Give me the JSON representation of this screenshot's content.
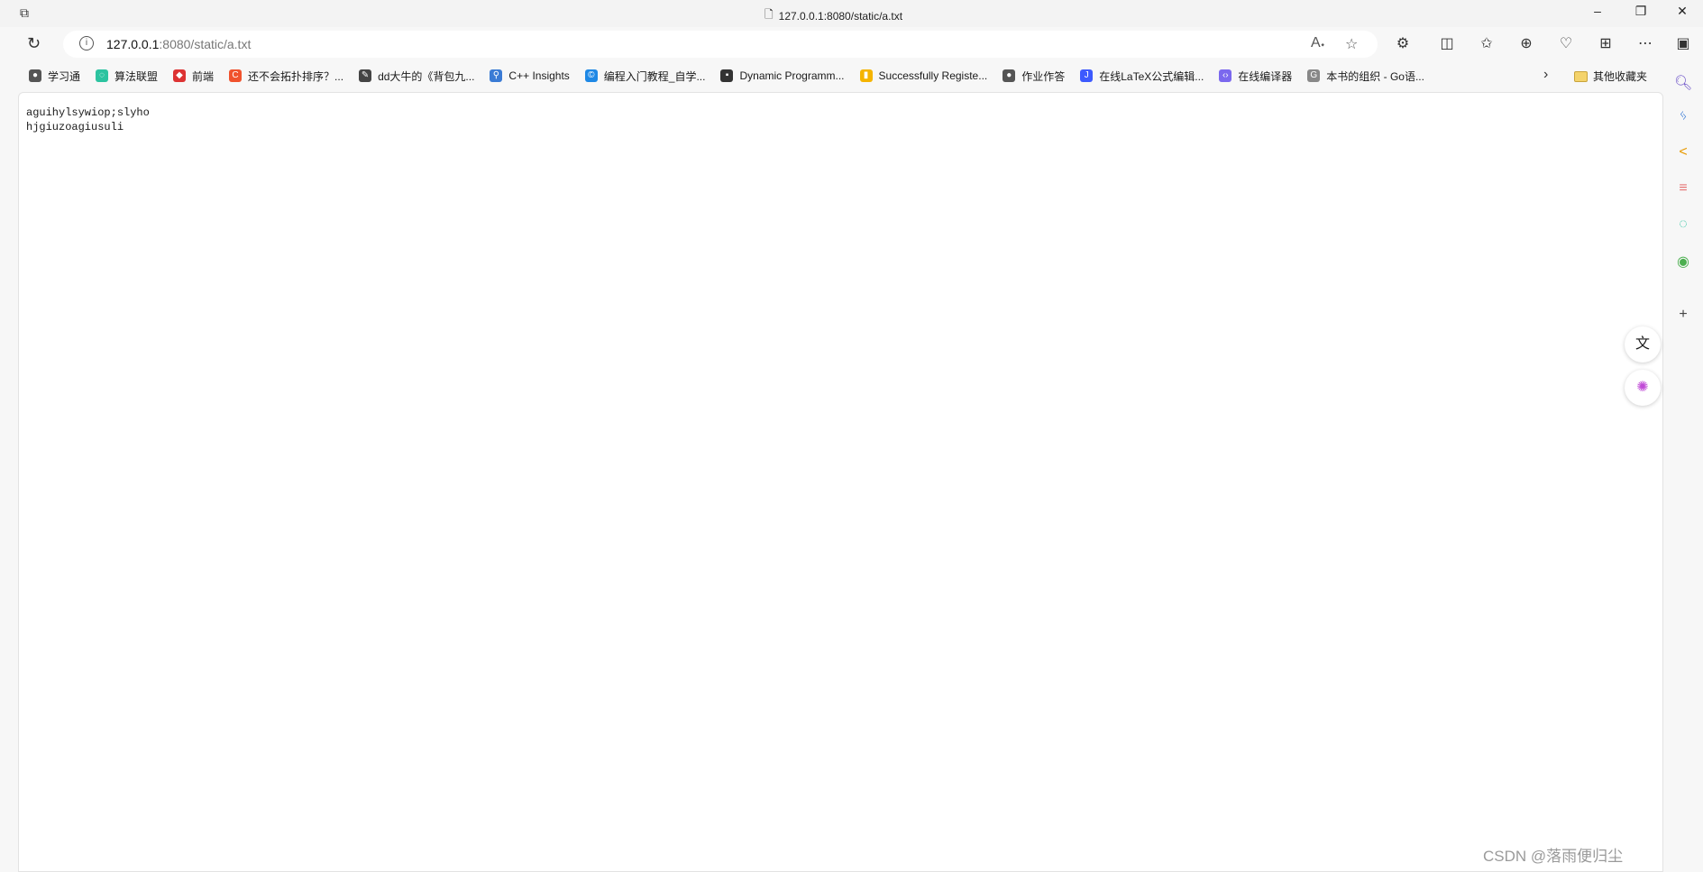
{
  "window": {
    "title": "127.0.0.1:8080/static/a.txt",
    "minimize": "–",
    "restore": "❐",
    "close": "✕"
  },
  "address_bar": {
    "host": "127.0.0.1",
    "rest": ":8080/static/a.txt"
  },
  "bookmarks": [
    {
      "label": "学习通",
      "icon": "globe-icon",
      "color": "#555"
    },
    {
      "label": "算法联盟",
      "icon": "ring-icon",
      "color": "#2cc3a0"
    },
    {
      "label": "前端",
      "icon": "shield-icon",
      "color": "#d33"
    },
    {
      "label": "还不会拓扑排序？...",
      "icon": "csdn-c-icon",
      "color": "#f0522d"
    },
    {
      "label": "dd大牛的《背包九...",
      "icon": "pen-icon",
      "color": "#444"
    },
    {
      "label": "C++ Insights",
      "icon": "magnifier-icon",
      "color": "#3a7bd5"
    },
    {
      "label": "编程入门教程_自学...",
      "icon": "c-badge-icon",
      "color": "#1e88e5"
    },
    {
      "label": "Dynamic Programm...",
      "icon": "terminal-icon",
      "color": "#333"
    },
    {
      "label": "Successfully Registe...",
      "icon": "bar-chart-icon",
      "color": "#f5b400"
    },
    {
      "label": "作业作答",
      "icon": "globe-icon",
      "color": "#555"
    },
    {
      "label": "在线LaTeX公式编辑...",
      "icon": "latex-icon",
      "color": "#3d5afe"
    },
    {
      "label": "在线编译器",
      "icon": "code-icon",
      "color": "#7b68ee"
    },
    {
      "label": "本书的组织 - Go语...",
      "icon": "g-icon",
      "color": "#888"
    }
  ],
  "other_bookmarks": "其他收藏夹",
  "document": {
    "lines": [
      "aguihylsywiop;slyho",
      "hjgiuzoagiusuli"
    ]
  },
  "watermark": "CSDN @落雨便归尘"
}
